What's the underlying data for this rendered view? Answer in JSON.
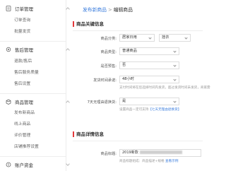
{
  "sidebar": {
    "groups": [
      {
        "title": "订单管理",
        "icon": "document-icon",
        "items": [
          "订单查询",
          "批量发货"
        ]
      },
      {
        "title": "售后管理",
        "icon": "gear-icon",
        "items": [
          "退款/售后",
          "售后服务质量",
          "售后设置"
        ]
      },
      {
        "title": "商品管理",
        "icon": "box-icon",
        "items": [
          "发布新商品",
          "线上商品",
          "评价管理",
          "店铺推荐设置"
        ]
      },
      {
        "title": "账户资金",
        "icon": "coin-icon",
        "items": []
      }
    ]
  },
  "breadcrumb": {
    "link": "发布新商品",
    "separator": ">",
    "current": "编辑商品"
  },
  "section1": {
    "title": "商品关键信息",
    "fields": [
      {
        "label": "商品分类:",
        "value": "居家日用",
        "value2": "挂衣"
      },
      {
        "label": "商品类型:",
        "value": "普通商品"
      },
      {
        "label": "是否预售:",
        "value": "否"
      },
      {
        "label": "发货时间承诺:",
        "value": "48小时",
        "hint": "支付时间将在您选择时间内发货，超过发货时间未发货，商家需"
      },
      {
        "label": "7天无理由退换货:",
        "value": "是",
        "hint_prefix": "设置商品一定可支持",
        "hint_link": "【七天无理由退换货】"
      }
    ]
  },
  "section2": {
    "title": "商品详情信息",
    "title_label": "商品标题:",
    "title_value": "2019新款",
    "title_hint_prefix": "商品标题组成：商品描述+规格",
    "title_hint_link": "查看示例"
  }
}
